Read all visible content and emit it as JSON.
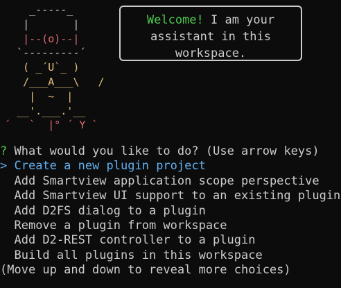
{
  "mascot": {
    "lines": [
      "    _-----_",
      "   |       |",
      "   |--(o)--|",
      "  `---------´",
      "   ( _´U`_ )",
      "   /___A___\\   /",
      "    |  ~  |",
      "  __'.___.'__",
      "´   `  |° ´ Y `"
    ]
  },
  "bubble": {
    "greeting": "Welcome!",
    "line1_rest": " I am your",
    "line2": "assistant in this",
    "line3": "workspace."
  },
  "prompt": {
    "question_mark": "?",
    "question": "What would you like to do?",
    "hint": "(Use arrow keys)",
    "pointer": ">",
    "choices": [
      "Create a new plugin project",
      "Add Smartview application scope perspective",
      "Add Smartview UI support to an existing plugin",
      "Add D2FS dialog to a plugin",
      "Remove a plugin from workspace",
      "Add D2-REST controller to a plugin",
      "Build all plugins in this workspace"
    ],
    "footer": "(Move up and down to reveal more choices)"
  },
  "colors": {
    "background": "#0c0c0c",
    "text": "#cccccc",
    "accent_green": "#4ec94e",
    "selected_blue": "#61afef",
    "mascot_red": "#e06c75",
    "mascot_yellow": "#e5c07b"
  }
}
